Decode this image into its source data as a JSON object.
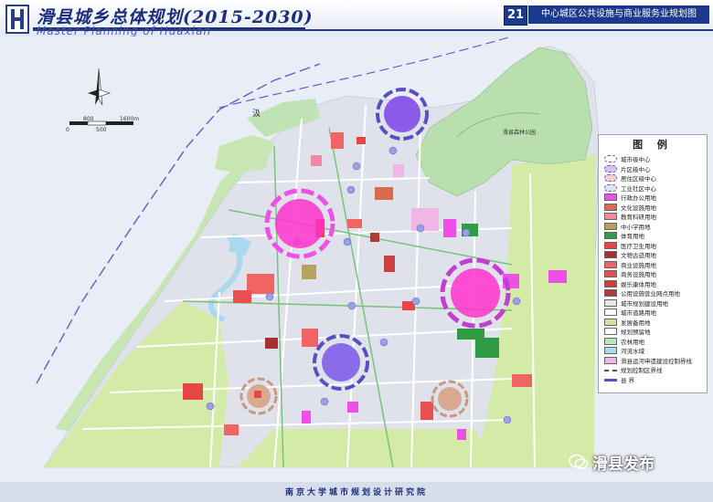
{
  "header": {
    "title_cn": "滑县城乡总体规划(2015-2030)",
    "title_en": "Master Planning of Huaxian",
    "sheet_number": "21",
    "sheet_title": "中心城区公共设施与商业服务业规划图"
  },
  "map": {
    "park_label": "滑县森林公园",
    "place_label": "汲",
    "scale_labels": [
      "0",
      "500",
      "800",
      "1600m"
    ]
  },
  "legend": {
    "title": "图 例",
    "items": [
      {
        "label": "城市级中心",
        "color": "#ffffff",
        "kind": "ring"
      },
      {
        "label": "片区级中心",
        "color": "#d7c4f0",
        "kind": "ring"
      },
      {
        "label": "居住区级中心",
        "color": "#ecd2c8",
        "kind": "ring"
      },
      {
        "label": "工业社区中心",
        "color": "#dfe4f3",
        "kind": "ring"
      },
      {
        "label": "行政办公用地",
        "color": "#ee4fe6",
        "kind": "fill"
      },
      {
        "label": "文化设施用地",
        "color": "#d86a4f",
        "kind": "fill"
      },
      {
        "label": "教育科研用地",
        "color": "#f08aa0",
        "kind": "fill"
      },
      {
        "label": "中小学用地",
        "color": "#b8a060",
        "kind": "fill"
      },
      {
        "label": "体育用地",
        "color": "#2f9b45",
        "kind": "fill"
      },
      {
        "label": "医疗卫生用地",
        "color": "#e64646",
        "kind": "fill"
      },
      {
        "label": "文物古迹用地",
        "color": "#a93030",
        "kind": "fill"
      },
      {
        "label": "商业设施用地",
        "color": "#f06464",
        "kind": "fill"
      },
      {
        "label": "商务设施用地",
        "color": "#e85050",
        "kind": "fill"
      },
      {
        "label": "娱乐康体用地",
        "color": "#c84040",
        "kind": "fill"
      },
      {
        "label": "公用设施营业网点用地",
        "color": "#b03a3a",
        "kind": "fill"
      },
      {
        "label": "城市规划建设用地",
        "color": "#e6e6e6",
        "kind": "fill"
      },
      {
        "label": "城市道路用地",
        "color": "#ffffff",
        "kind": "fill"
      },
      {
        "label": "发展备用地",
        "color": "#cde89a",
        "kind": "fill"
      },
      {
        "label": "规划预留地",
        "color": "#ffffff",
        "kind": "fill"
      },
      {
        "label": "农林用地",
        "color": "#bde6b8",
        "kind": "fill"
      },
      {
        "label": "河流水域",
        "color": "#a9d8ef",
        "kind": "fill"
      },
      {
        "label": "滑县运河申遗建设控制界线",
        "color": "#f2b6e6",
        "kind": "fill"
      },
      {
        "label": "规划控制区界线",
        "color": "#ffffff",
        "kind": "dashed"
      },
      {
        "label": "县 界",
        "color": "#5a4fc2",
        "kind": "line"
      }
    ]
  },
  "footer": {
    "institute": "南京大学城市规划设计研究院"
  },
  "watermark": {
    "text": "滑县发布"
  },
  "colors": {
    "title_blue": "#1b2f7a",
    "city_center": "#ff33cc",
    "district_center": "#7b4be0",
    "residential_center": "#c79a80",
    "green_belt": "#c8e6b4",
    "reserve": "#d4eba8"
  }
}
